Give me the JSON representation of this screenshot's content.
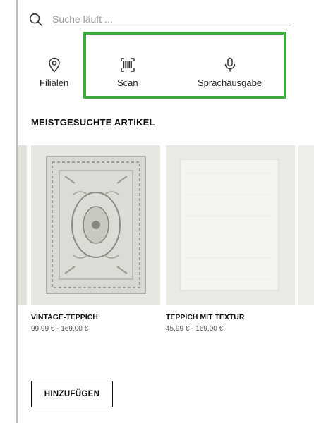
{
  "search": {
    "placeholder": "Suche läuft ..."
  },
  "actions": {
    "filialen": {
      "label": "Filialen",
      "icon": "location-pin-icon"
    },
    "scan": {
      "label": "Scan",
      "icon": "barcode-scan-icon"
    },
    "voice": {
      "label": "Sprachausgabe",
      "icon": "microphone-icon"
    },
    "highlight_color": "#3eaa3e"
  },
  "section": {
    "title": "MEISTGESUCHTE ARTIKEL"
  },
  "products": [
    {
      "title": "VINTAGE-TEPPICH",
      "price": "99,99 € - 169,00 €"
    },
    {
      "title": "TEPPICH MIT TEXTUR",
      "price": "45,99 € - 169,00 €"
    }
  ],
  "add_button": {
    "label": "HINZUFÜGEN"
  }
}
